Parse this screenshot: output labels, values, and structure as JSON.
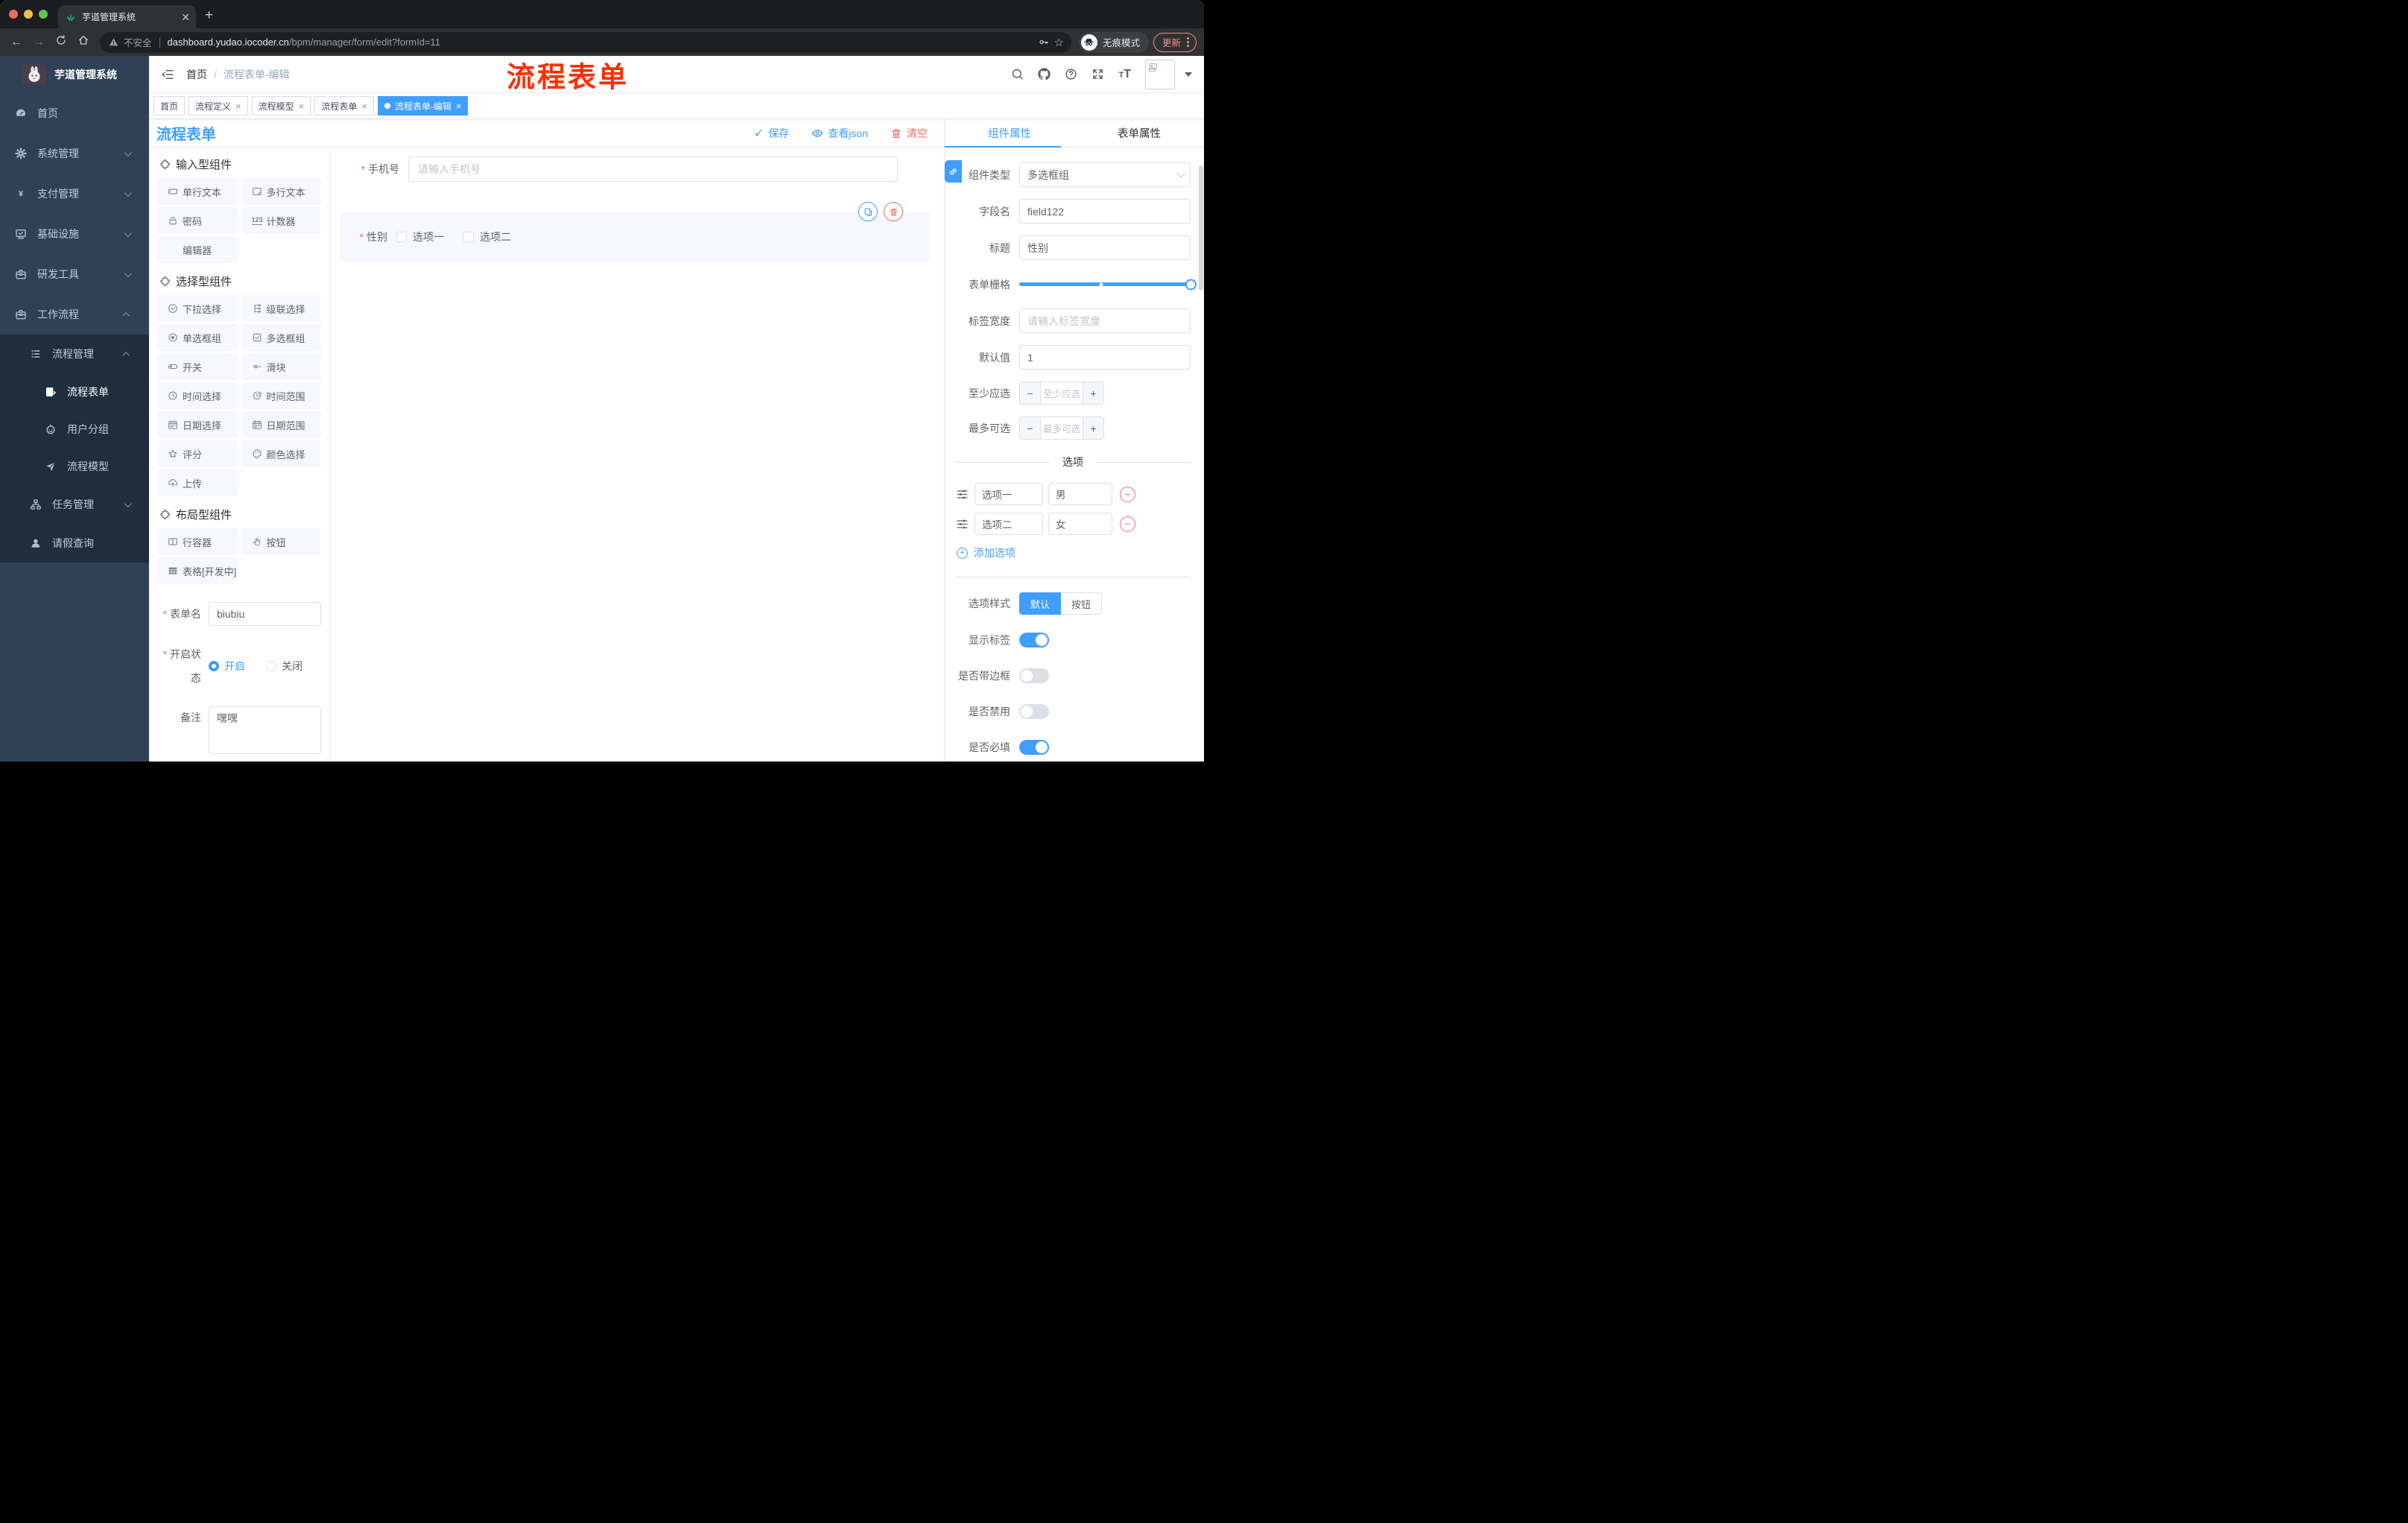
{
  "browser": {
    "tab_title": "芋道管理系统",
    "not_secure": "不安全",
    "url_host": "dashboard.yudao.iocoder.cn",
    "url_path": "/bpm/manager/form/edit?formId=11",
    "incognito_label": "无痕模式",
    "update_label": "更新"
  },
  "sidebar": {
    "app_title": "芋道管理系统",
    "items": [
      {
        "label": "首页",
        "icon": "dashboard",
        "level": 1
      },
      {
        "label": "系统管理",
        "icon": "gear",
        "level": 1,
        "chevron": "down"
      },
      {
        "label": "支付管理",
        "icon": "yen",
        "level": 1,
        "chevron": "down"
      },
      {
        "label": "基础设施",
        "icon": "monitor",
        "level": 1,
        "chevron": "down"
      },
      {
        "label": "研发工具",
        "icon": "suitcase",
        "level": 1,
        "chevron": "down"
      },
      {
        "label": "工作流程",
        "icon": "suitcase",
        "level": 1,
        "chevron": "up"
      },
      {
        "label": "流程管理",
        "icon": "list",
        "level": 2,
        "chevron": "up",
        "sub": true
      },
      {
        "label": "流程表单",
        "icon": "doc-edit",
        "level": 3,
        "sub": true,
        "active": true
      },
      {
        "label": "用户分组",
        "icon": "robot",
        "level": 3,
        "sub": true
      },
      {
        "label": "流程模型",
        "icon": "send",
        "level": 3,
        "sub": true
      },
      {
        "label": "任务管理",
        "icon": "tree",
        "level": 2,
        "chevron": "down",
        "sub": true
      },
      {
        "label": "请假查询",
        "icon": "user",
        "level": 2,
        "sub": true
      }
    ]
  },
  "header": {
    "breadcrumb_home": "首页",
    "breadcrumb_current": "流程表单-编辑",
    "watermark": "流程表单"
  },
  "tags": [
    {
      "label": "首页"
    },
    {
      "label": "流程定义",
      "closable": true
    },
    {
      "label": "流程模型",
      "closable": true
    },
    {
      "label": "流程表单",
      "closable": true
    },
    {
      "label": "流程表单-编辑",
      "closable": true,
      "active": true
    }
  ],
  "designer": {
    "title": "流程表单",
    "save_label": "保存",
    "view_json_label": "查看json",
    "clear_label": "清空",
    "palette_sections": [
      {
        "title": "输入型组件",
        "items": [
          {
            "label": "单行文本",
            "icon": "input"
          },
          {
            "label": "多行文本",
            "icon": "textarea"
          },
          {
            "label": "密码",
            "icon": "lock"
          },
          {
            "label": "计数器",
            "icon": "counter"
          },
          {
            "label": "编辑器",
            "icon": "none"
          }
        ]
      },
      {
        "title": "选择型组件",
        "items": [
          {
            "label": "下拉选择",
            "icon": "select"
          },
          {
            "label": "级联选择",
            "icon": "cascade"
          },
          {
            "label": "单选框组",
            "icon": "radio"
          },
          {
            "label": "多选框组",
            "icon": "checkbox"
          },
          {
            "label": "开关",
            "icon": "switch"
          },
          {
            "label": "滑块",
            "icon": "slider"
          },
          {
            "label": "时间选择",
            "icon": "time"
          },
          {
            "label": "时间范围",
            "icon": "time-range"
          },
          {
            "label": "日期选择",
            "icon": "date"
          },
          {
            "label": "日期范围",
            "icon": "date-range"
          },
          {
            "label": "评分",
            "icon": "star"
          },
          {
            "label": "颜色选择",
            "icon": "color"
          },
          {
            "label": "上传",
            "icon": "upload"
          }
        ]
      },
      {
        "title": "布局型组件",
        "items": [
          {
            "label": "行容器",
            "icon": "row"
          },
          {
            "label": "按钮",
            "icon": "button"
          },
          {
            "label": "表格[开发中]",
            "icon": "table"
          }
        ]
      }
    ],
    "meta": {
      "form_name_label": "表单名",
      "form_name_value": "biubiu",
      "status_label": "开启状态",
      "status_on": "开启",
      "status_off": "关闭",
      "remark_label": "备注",
      "remark_value": "嘿嘿"
    },
    "canvas": {
      "phone_label": "手机号",
      "phone_placeholder": "请输入手机号",
      "gender_label": "性别",
      "gender_options": [
        "选项一",
        "选项二"
      ]
    }
  },
  "props": {
    "tab_component": "组件属性",
    "tab_form": "表单属性",
    "component_type_label": "组件类型",
    "component_type_value": "多选框组",
    "field_name_label": "字段名",
    "field_name_value": "field122",
    "title_label": "标题",
    "title_value": "性别",
    "grid_label": "表单栅格",
    "label_width_label": "标签宽度",
    "label_width_placeholder": "请输入标签宽度",
    "default_label": "默认值",
    "default_value": "1",
    "min_label": "至少应选",
    "min_placeholder": "至少应选",
    "max_label": "最多可选",
    "max_placeholder": "最多可选",
    "options_divider": "选项",
    "options": [
      {
        "name": "选项一",
        "value": "男"
      },
      {
        "name": "选项二",
        "value": "女"
      }
    ],
    "add_option_label": "添加选项",
    "option_style_label": "选项样式",
    "option_style_choices": [
      "默认",
      "按钮"
    ],
    "option_style_active": "默认",
    "toggles": [
      {
        "label": "显示标签",
        "on": true
      },
      {
        "label": "是否带边框",
        "on": false
      },
      {
        "label": "是否禁用",
        "on": false
      },
      {
        "label": "是否必填",
        "on": true
      }
    ]
  },
  "colors": {
    "accent": "#409eff",
    "danger": "#f56c6c",
    "sidebar_bg": "#304156",
    "submenu_bg": "#1f2d3d",
    "watermark_red": "#ff2e00"
  }
}
